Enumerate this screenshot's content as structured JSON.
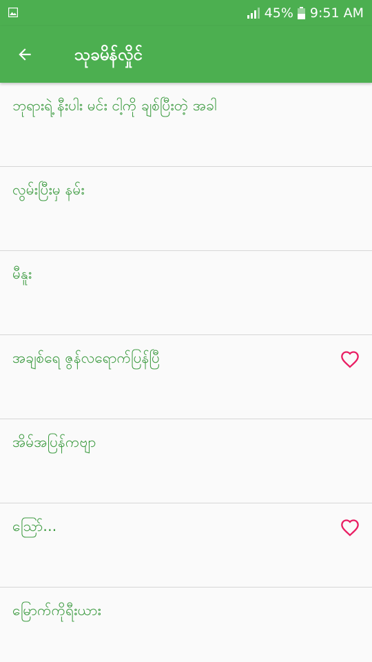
{
  "status_bar": {
    "battery_percent": "45%",
    "time": "9:51 AM",
    "icons": [
      "image-icon",
      "signal-icon",
      "battery-icon"
    ]
  },
  "app_bar": {
    "title": "သုခမိန်လှိုင်",
    "back_icon": "arrow-left-icon"
  },
  "colors": {
    "primary": "#4caf50",
    "song_text": "#3d9b41",
    "heart": "#e91e63",
    "divider": "#d6d6d6",
    "background": "#fafafa"
  },
  "songs": [
    {
      "title": "ဘုရားရဲ့ နီးပါး မင်း ငါ့ကို ချစ်ပြီးတဲ့ အခါ",
      "favorite_icon_shown": false
    },
    {
      "title": "လွမ်းပြီးမှ နမ်း",
      "favorite_icon_shown": false
    },
    {
      "title": "မီနူး",
      "favorite_icon_shown": false
    },
    {
      "title": "အချစ်ရေ ဇွန်လရောက်ပြန်ပြီ",
      "favorite_icon_shown": true
    },
    {
      "title": "အိမ်အပြန်ကဗျာ",
      "favorite_icon_shown": false
    },
    {
      "title": "ဩော်...",
      "favorite_icon_shown": true
    },
    {
      "title": "မြောက်ကိုရီးယား",
      "favorite_icon_shown": false
    }
  ]
}
